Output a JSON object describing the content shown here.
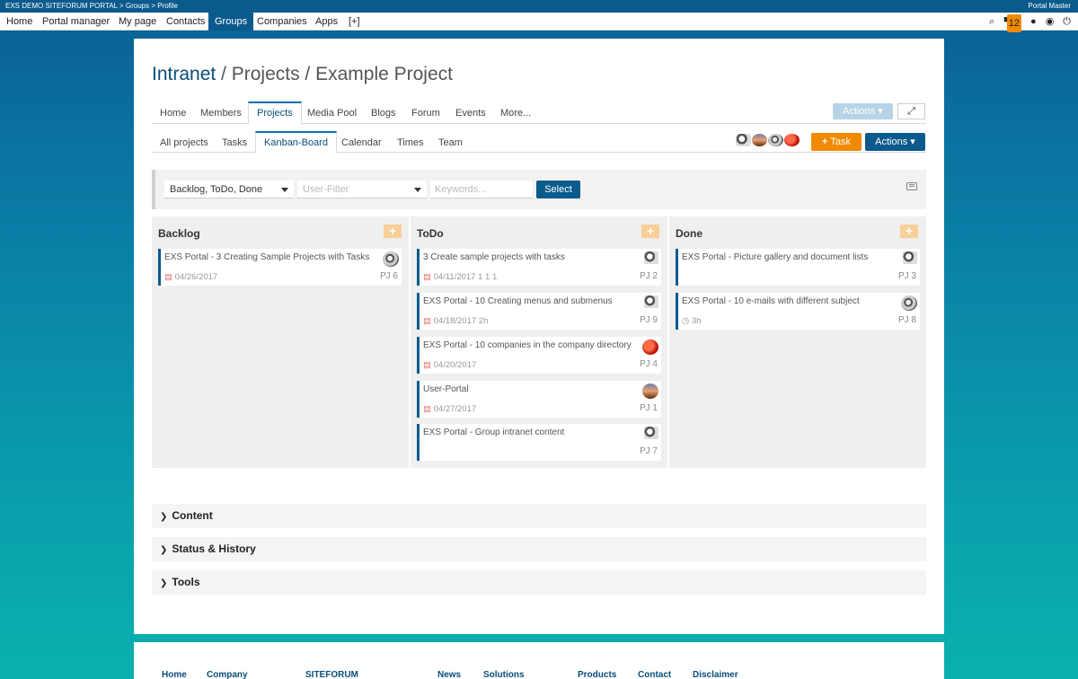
{
  "topbar": {
    "path": "EXS DEMO SITEFORUM PORTAL > Groups > Profile",
    "user": "Portal Master"
  },
  "mainnav": {
    "items": [
      "Home",
      "Portal manager",
      "My page",
      "Contacts",
      "Groups",
      "Companies",
      "Apps",
      "[+]"
    ],
    "active": "Groups",
    "notification_count": "12"
  },
  "page": {
    "breadcrumb_root": "Intranet",
    "breadcrumb_rest": " / Projects / Example Project"
  },
  "tabs1": {
    "items": [
      "Home",
      "Members",
      "Projects",
      "Media Pool",
      "Blogs",
      "Forum",
      "Events",
      "More..."
    ],
    "active": "Projects",
    "actions_label": "Actions"
  },
  "tabs2": {
    "items": [
      "All projects",
      "Tasks",
      "Kanban-Board",
      "Calendar",
      "Times",
      "Team"
    ],
    "active": "Kanban-Board",
    "task_button": "Task",
    "actions_label": "Actions"
  },
  "filter": {
    "status_value": "Backlog, ToDo, Done",
    "user_placeholder": "User-Filter",
    "keywords_placeholder": "Keywords...",
    "select_label": "Select"
  },
  "kanban": {
    "columns": [
      {
        "title": "Backlog",
        "cards": [
          {
            "title": "EXS Portal - 3 Creating Sample Projects with Tasks",
            "meta": "04/26/2017",
            "id": "PJ 6",
            "avatar": "ball-icon"
          }
        ]
      },
      {
        "title": "ToDo",
        "cards": [
          {
            "title": "3 Create sample projects with tasks",
            "meta": "04/11/2017   1   1   1",
            "id": "PJ 2",
            "avatar": "bw-icon"
          },
          {
            "title": "EXS Portal - 10 Creating menus and submenus",
            "meta": "04/18/2017   2h",
            "id": "PJ 9",
            "avatar": "bw-icon"
          },
          {
            "title": "EXS Portal - 10 companies in the company directory",
            "meta": "04/20/2017",
            "id": "PJ 4",
            "avatar": "red-icon"
          },
          {
            "title": "User-Portal",
            "meta": "04/27/2017",
            "id": "PJ 1",
            "avatar": "sunset-icon"
          },
          {
            "title": "EXS Portal - Group intranet content",
            "meta": "",
            "id": "PJ 7",
            "avatar": "bw-icon"
          }
        ]
      },
      {
        "title": "Done",
        "cards": [
          {
            "title": "EXS Portal - Picture gallery and document lists",
            "meta": "",
            "id": "PJ 3",
            "avatar": "bw-icon"
          },
          {
            "title": "EXS Portal - 10 e-mails with different subject",
            "meta": "3h",
            "id": "PJ 8",
            "avatar": "ball-icon"
          }
        ]
      }
    ]
  },
  "sections": [
    "Content",
    "Status & History",
    "Tools"
  ],
  "footer": {
    "links": [
      "Home",
      "Company",
      "SITEFORUM",
      "News",
      "Solutions",
      "Products",
      "Contact",
      "Disclaimer"
    ]
  }
}
